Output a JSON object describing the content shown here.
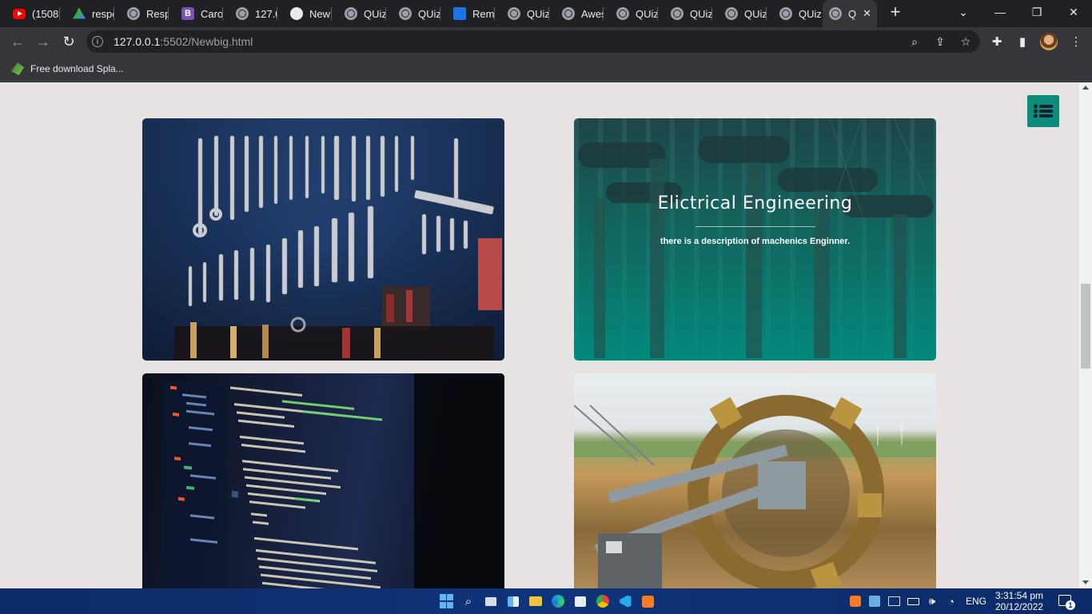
{
  "browser": {
    "tabs": [
      {
        "title": "(1508",
        "icon": "youtube-icon"
      },
      {
        "title": "respo",
        "icon": "google-drive-icon"
      },
      {
        "title": "Resp",
        "icon": "globe-icon"
      },
      {
        "title": "Caro",
        "icon": "bootstrap-icon"
      },
      {
        "title": "127.0",
        "icon": "globe-icon"
      },
      {
        "title": "New",
        "icon": "github-icon"
      },
      {
        "title": "QUiz",
        "icon": "globe-icon"
      },
      {
        "title": "QUiz",
        "icon": "globe-icon"
      },
      {
        "title": "Remi",
        "icon": "remix-icon"
      },
      {
        "title": "QUiz",
        "icon": "globe-icon"
      },
      {
        "title": "Awes",
        "icon": "globe-icon"
      },
      {
        "title": "QUiz",
        "icon": "globe-icon"
      },
      {
        "title": "QUiz",
        "icon": "globe-icon"
      },
      {
        "title": "QUiz",
        "icon": "globe-icon"
      },
      {
        "title": "QUiz",
        "icon": "globe-icon"
      },
      {
        "title": "Q",
        "icon": "globe-icon",
        "active": true
      }
    ],
    "url_host": "127.0.0.1",
    "url_path": ":5502/Newbig.html",
    "bookmark": "Free download Spla..."
  },
  "page": {
    "cards": [
      {
        "name": "mechanical-tools-card",
        "image": "wrenches-on-pegboard"
      },
      {
        "name": "electrical-engineering-card",
        "title": "Elictrical Engineering",
        "description": "there is a description of machenics Enginner.",
        "image": "power-transmission-insulators"
      },
      {
        "name": "software-code-card",
        "image": "code-on-laptop-screen"
      },
      {
        "name": "mining-machine-card",
        "image": "bucket-wheel-excavator"
      }
    ],
    "accent_color": "#0a8d7c"
  },
  "taskbar": {
    "language": "ENG",
    "time": "3:31:54 pm",
    "date": "20/12/2022",
    "notification_count": "1"
  }
}
